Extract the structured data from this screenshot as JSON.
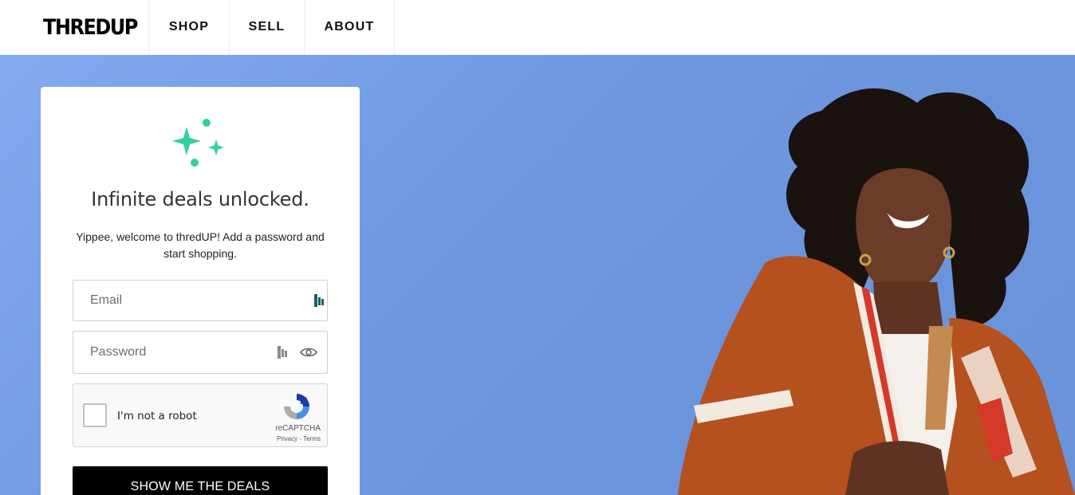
{
  "header": {
    "logo": "THREDUP",
    "nav": [
      {
        "label": "SHOP"
      },
      {
        "label": "SELL"
      },
      {
        "label": "ABOUT"
      }
    ]
  },
  "card": {
    "title": "Infinite deals unlocked.",
    "subtitle": "Yippee, welcome to thredUP! Add a password and start shopping.",
    "email": {
      "placeholder": "Email",
      "value": ""
    },
    "password": {
      "placeholder": "Password",
      "value": ""
    },
    "recaptcha": {
      "label": "I'm not a robot",
      "brand": "reCAPTCHA",
      "links": "Privacy - Terms",
      "checked": false
    },
    "cta_label": "SHOW ME THE DEALS"
  },
  "colors": {
    "accent": "#2fd39a",
    "sky": "#7099e0",
    "button": "#000000",
    "cardigan": "#b5501f"
  },
  "icons": [
    "sparkle-icon",
    "password-manager-icon",
    "eye-icon",
    "recaptcha-logo-icon"
  ]
}
